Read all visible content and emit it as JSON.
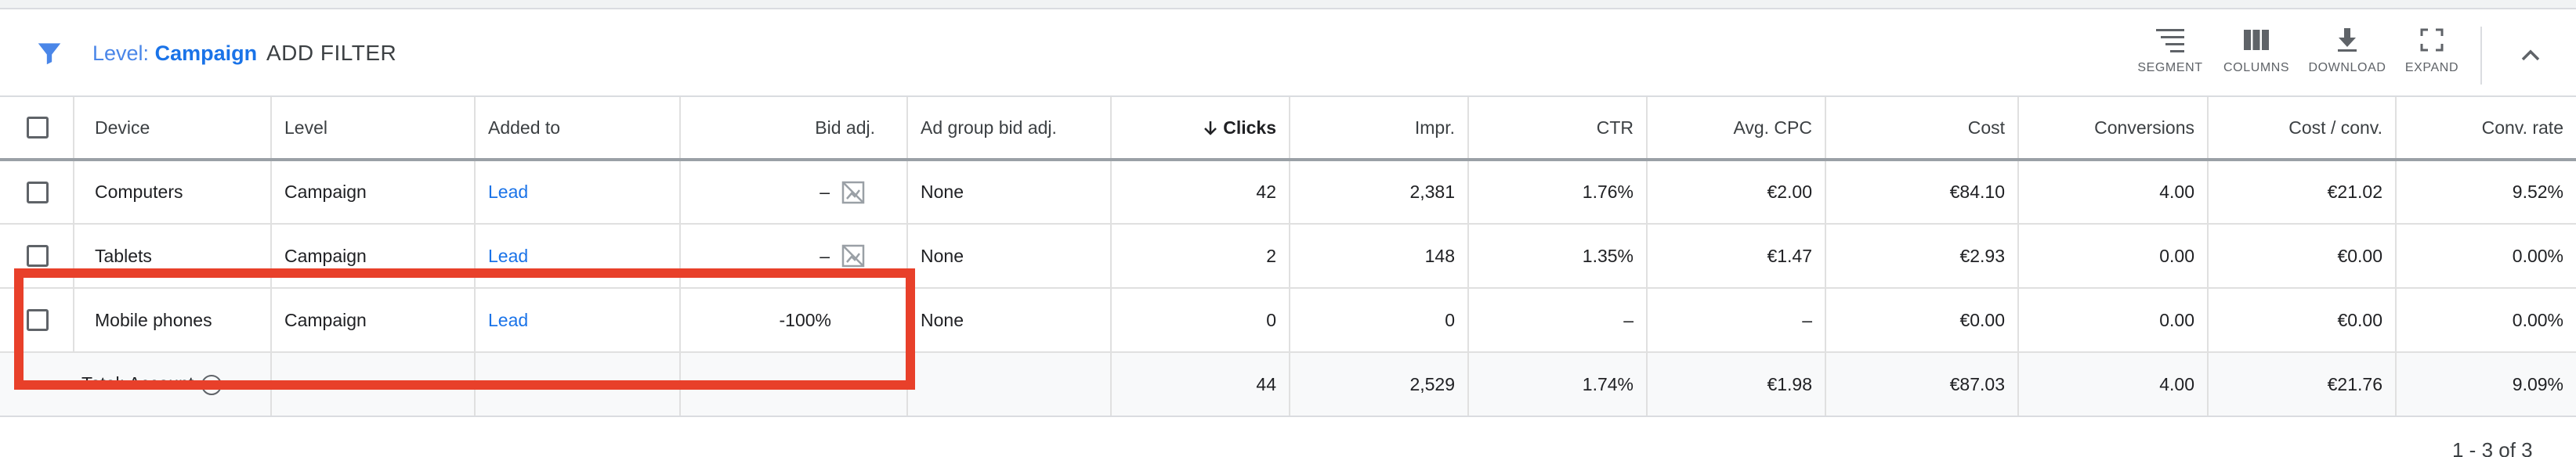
{
  "filter": {
    "level_label": "Level:",
    "level_value": "Campaign",
    "add_filter": "ADD FILTER"
  },
  "toolbar": {
    "segment": "SEGMENT",
    "columns": "COLUMNS",
    "download": "DOWNLOAD",
    "expand": "EXPAND"
  },
  "columns": [
    "Device",
    "Level",
    "Added to",
    "Bid adj.",
    "Ad group bid adj.",
    "Clicks",
    "Impr.",
    "CTR",
    "Avg. CPC",
    "Cost",
    "Conversions",
    "Cost / conv.",
    "Conv. rate"
  ],
  "rows": [
    {
      "device": "Computers",
      "level": "Campaign",
      "added_to": "Lead",
      "bid_adj": "–",
      "ag_bid_adj": "None",
      "clicks": "42",
      "impr": "2,381",
      "ctr": "1.76%",
      "avg_cpc": "€2.00",
      "cost": "€84.10",
      "conversions": "4.00",
      "cost_conv": "€21.02",
      "conv_rate": "9.52%"
    },
    {
      "device": "Tablets",
      "level": "Campaign",
      "added_to": "Lead",
      "bid_adj": "–",
      "ag_bid_adj": "None",
      "clicks": "2",
      "impr": "148",
      "ctr": "1.35%",
      "avg_cpc": "€1.47",
      "cost": "€2.93",
      "conversions": "0.00",
      "cost_conv": "€0.00",
      "conv_rate": "0.00%"
    },
    {
      "device": "Mobile phones",
      "level": "Campaign",
      "added_to": "Lead",
      "bid_adj": "-100%",
      "ag_bid_adj": "None",
      "clicks": "0",
      "impr": "0",
      "ctr": "–",
      "avg_cpc": "–",
      "cost": "€0.00",
      "conversions": "0.00",
      "cost_conv": "€0.00",
      "conv_rate": "0.00%"
    }
  ],
  "total": {
    "label": "Total: Account",
    "clicks": "44",
    "impr": "2,529",
    "ctr": "1.74%",
    "avg_cpc": "€1.98",
    "cost": "€87.03",
    "conversions": "4.00",
    "cost_conv": "€21.76",
    "conv_rate": "9.09%"
  },
  "pager": "1 - 3 of 3",
  "colors": {
    "accent": "#1a73e8",
    "highlight": "#e8402a"
  }
}
